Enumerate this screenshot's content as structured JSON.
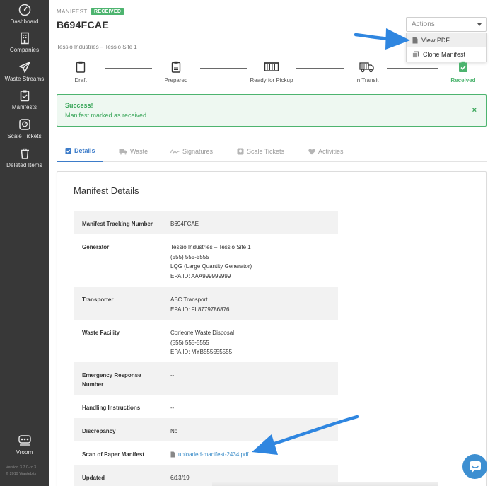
{
  "sidebar": {
    "items": [
      {
        "label": "Dashboard",
        "icon": "gauge-icon"
      },
      {
        "label": "Companies",
        "icon": "building-icon"
      },
      {
        "label": "Waste Streams",
        "icon": "paper-plane-icon"
      },
      {
        "label": "Manifests",
        "icon": "clipboard-check-icon"
      },
      {
        "label": "Scale Tickets",
        "icon": "scale-icon"
      },
      {
        "label": "Deleted Items",
        "icon": "trash-icon"
      }
    ],
    "bottom": {
      "label": "Vroom",
      "icon": "vroom-icon"
    },
    "version": "Version 3.7.0-rc.3",
    "copyright": "© 2019 Wastebits"
  },
  "header": {
    "kicker": "MANIFEST",
    "badge": "RECEIVED",
    "manifest_id": "B694FCAE",
    "subtitle": "Tessio Industries – Tessio Site 1"
  },
  "actions": {
    "label": "Actions",
    "items": [
      {
        "label": "View PDF",
        "icon": "file-icon"
      },
      {
        "label": "Clone Manifest",
        "icon": "copy-icon"
      }
    ]
  },
  "progress": {
    "steps": [
      {
        "label": "Draft"
      },
      {
        "label": "Prepared"
      },
      {
        "label": "Ready for Pickup"
      },
      {
        "label": "In Transit"
      },
      {
        "label": "Received"
      }
    ]
  },
  "alert": {
    "title": "Success!",
    "message": "Manifest marked as received.",
    "close": "×"
  },
  "tabs": [
    {
      "label": "Details"
    },
    {
      "label": "Waste"
    },
    {
      "label": "Signatures"
    },
    {
      "label": "Scale Tickets"
    },
    {
      "label": "Activities"
    }
  ],
  "details": {
    "title": "Manifest Details",
    "rows": [
      {
        "label": "Manifest Tracking Number",
        "lines": [
          "B694FCAE"
        ]
      },
      {
        "label": "Generator",
        "lines": [
          "Tessio Industries – Tessio Site 1",
          "(555) 555-5555",
          "LQG (Large Quantity Generator)",
          "EPA ID: AAA999999999"
        ]
      },
      {
        "label": "Transporter",
        "lines": [
          "ABC Transport",
          "EPA ID: FL8779786876"
        ]
      },
      {
        "label": "Waste Facility",
        "lines": [
          "Corleone Waste Disposal",
          "(555) 555-5555",
          "EPA ID: MYB555555555"
        ]
      },
      {
        "label": "Emergency Response Number",
        "lines": [
          "--"
        ]
      },
      {
        "label": "Handling Instructions",
        "lines": [
          "--"
        ]
      },
      {
        "label": "Discrepancy",
        "lines": [
          "No"
        ]
      },
      {
        "label": "Scan of Paper Manifest",
        "lines": [
          "uploaded-manifest-2434.pdf"
        ]
      },
      {
        "label": "Updated",
        "lines": [
          "6/13/19"
        ]
      }
    ]
  },
  "colors": {
    "sidebar": "#383838",
    "success": "#4db46f",
    "link": "#3d8ec9",
    "active_tab": "#3d7cc9",
    "arrow": "#2f86e0"
  }
}
